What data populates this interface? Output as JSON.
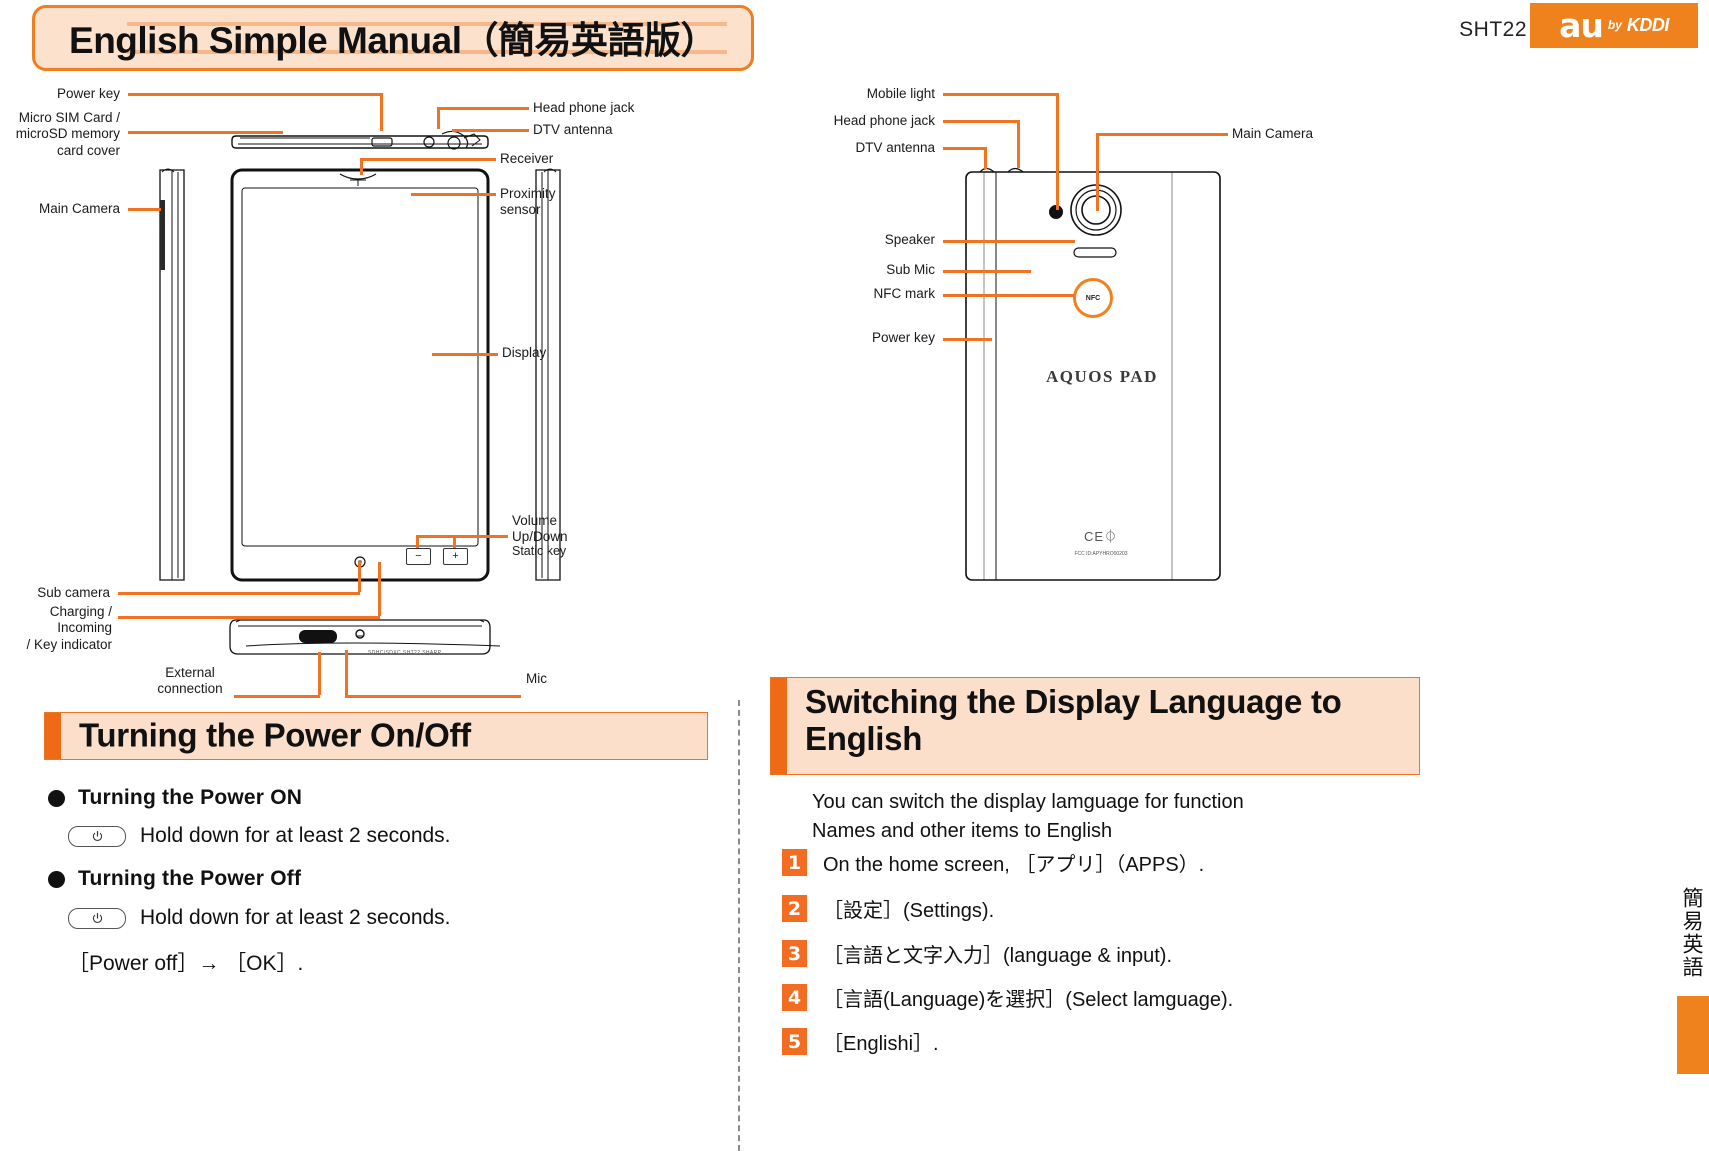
{
  "header": {
    "title": "English Simple Manual（簡易英語版）",
    "model": "SHT22",
    "logo": {
      "brand": "au",
      "by": "by",
      "carrier": "KDDI"
    }
  },
  "front_diagram": {
    "labels": {
      "power_key": "Power key",
      "sim_cover": "Micro SIM Card /\nmicroSD memory\ncard cover",
      "main_camera": "Main Camera",
      "head_phone_jack": "Head phone jack",
      "dtv_antenna": "DTV antenna",
      "receiver": "Receiver",
      "proximity_sensor": "Proximity\nsensor",
      "display": "Display",
      "volume": "Volume\nUp/Down",
      "static_key": "Static key",
      "sub_camera": "Sub camera",
      "indicator": "Charging / Incoming\n/ Key indicator",
      "external_connection": "External\nconnection",
      "mic": "Mic"
    },
    "volume_minus": "−",
    "volume_plus": "+",
    "bottom_print": "SDHC/SDXC  SHT22  SHARP"
  },
  "back_diagram": {
    "labels": {
      "mobile_light": "Mobile light",
      "head_phone_jack": "Head phone jack",
      "dtv_antenna": "DTV antenna",
      "main_camera": "Main Camera",
      "speaker": "Speaker",
      "sub_mic": "Sub Mic",
      "nfc_mark": "NFC mark",
      "power_key": "Power key"
    },
    "nfc_text": "NFC",
    "brand_text": "AQUOS PAD",
    "ce_text": "CE",
    "ce_sub": "FCC ID:APYHRO00203"
  },
  "power_section": {
    "heading": "Turning the Power On/Off",
    "on_label": "Turning the Power ON",
    "on_instruction": "Hold down for at least 2 seconds.",
    "off_label": "Turning the Power Off",
    "off_instruction": "Hold down for at least 2 seconds.",
    "off_confirm": "［Power off］→ ［OK］."
  },
  "language_section": {
    "heading": "Switching the Display Language to English",
    "intro": "You can switch the display lamguage for function\nNames and other items to English",
    "steps": [
      {
        "num": "1",
        "text": "On the home screen, ［アプリ］（APPS）."
      },
      {
        "num": "2",
        "text": "［設定］(Settings)."
      },
      {
        "num": "3",
        "text": "［言語と文字入力］(language & input)."
      },
      {
        "num": "4",
        "text": "［言語(Language)を選択］(Select lamguage)."
      },
      {
        "num": "5",
        "text": "［Englishi］."
      }
    ]
  },
  "side_tab": {
    "text": "簡易英語"
  },
  "colors": {
    "accent": "#ef7320",
    "accent_dark": "#f0821e",
    "panel": "#fbdfcb"
  }
}
